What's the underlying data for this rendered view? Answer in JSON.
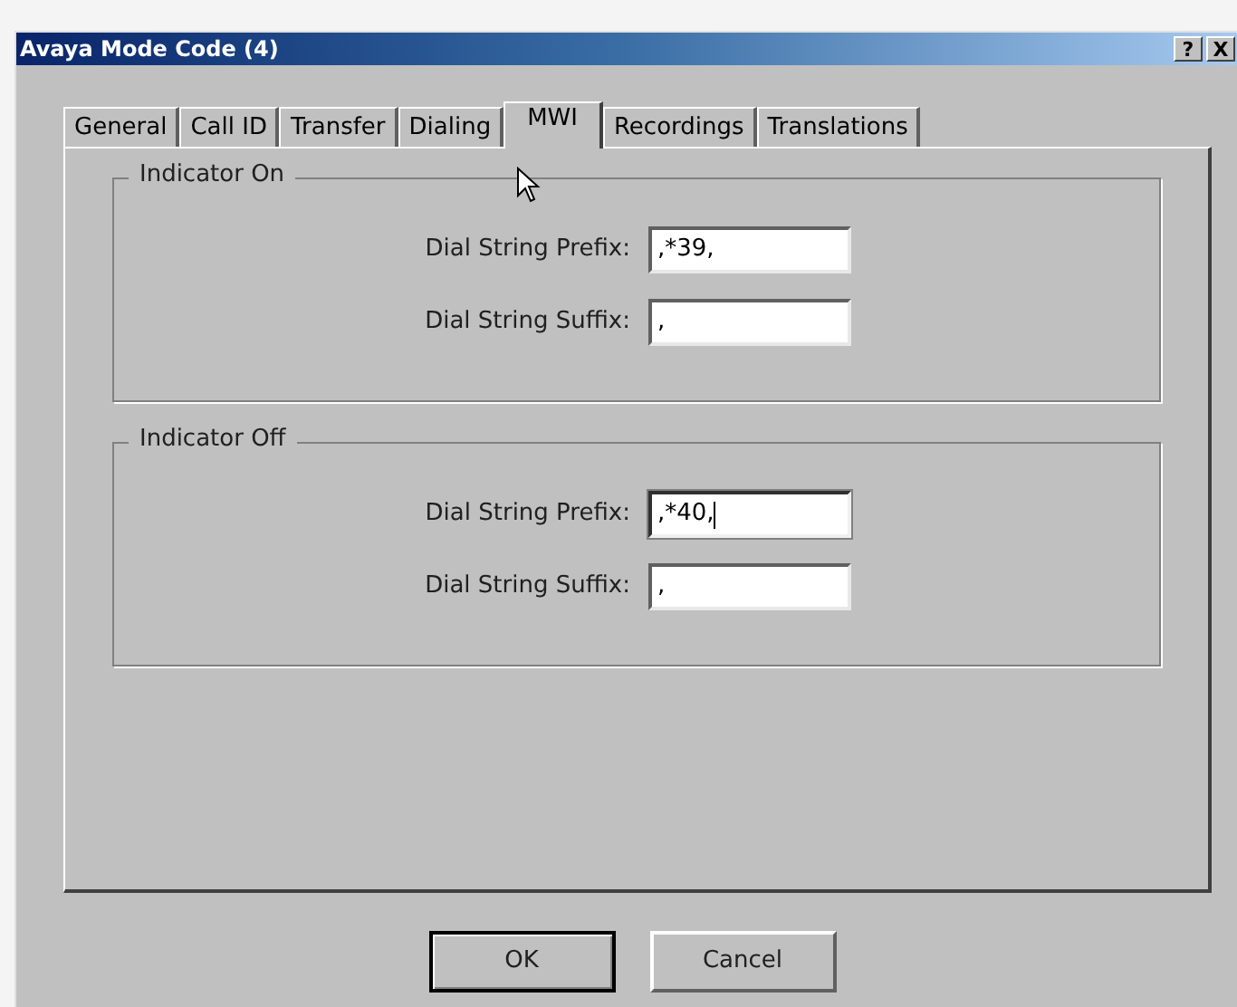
{
  "window": {
    "title": "Avaya Mode Code (4)",
    "help_button": "?",
    "close_button": "X"
  },
  "tabs": [
    {
      "label": "General",
      "selected": false
    },
    {
      "label": "Call ID",
      "selected": false
    },
    {
      "label": "Transfer",
      "selected": false
    },
    {
      "label": "Dialing",
      "selected": false
    },
    {
      "label": "MWI",
      "selected": true
    },
    {
      "label": "Recordings",
      "selected": false
    },
    {
      "label": "Translations",
      "selected": false
    }
  ],
  "groups": [
    {
      "title": "Indicator On",
      "fields": [
        {
          "label": "Dial String Prefix:",
          "value": ",*39,",
          "focused": false
        },
        {
          "label": "Dial String Suffix:",
          "value": ",",
          "focused": false
        }
      ]
    },
    {
      "title": "Indicator Off",
      "fields": [
        {
          "label": "Dial String Prefix:",
          "value": ",*40,",
          "focused": true
        },
        {
          "label": "Dial String Suffix:",
          "value": ",",
          "focused": false
        }
      ]
    }
  ],
  "buttons": [
    {
      "label": "OK",
      "default": true
    },
    {
      "label": "Cancel",
      "default": false
    }
  ]
}
